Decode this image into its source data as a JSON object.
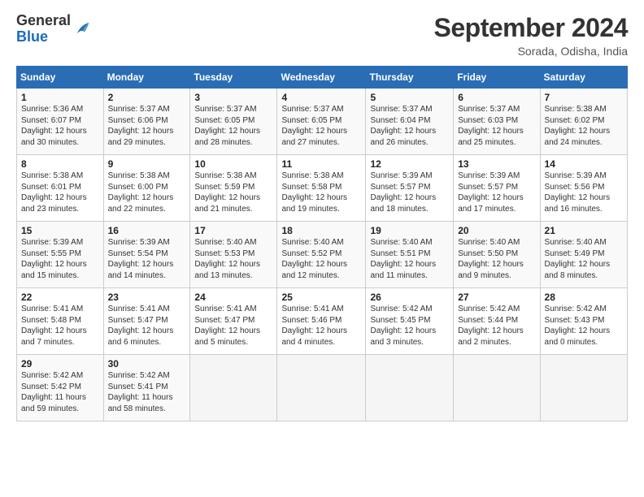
{
  "header": {
    "logo_line1": "General",
    "logo_line2": "Blue",
    "month": "September 2024",
    "location": "Sorada, Odisha, India"
  },
  "weekdays": [
    "Sunday",
    "Monday",
    "Tuesday",
    "Wednesday",
    "Thursday",
    "Friday",
    "Saturday"
  ],
  "weeks": [
    [
      {
        "day": "1",
        "info": "Sunrise: 5:36 AM\nSunset: 6:07 PM\nDaylight: 12 hours\nand 30 minutes."
      },
      {
        "day": "2",
        "info": "Sunrise: 5:37 AM\nSunset: 6:06 PM\nDaylight: 12 hours\nand 29 minutes."
      },
      {
        "day": "3",
        "info": "Sunrise: 5:37 AM\nSunset: 6:05 PM\nDaylight: 12 hours\nand 28 minutes."
      },
      {
        "day": "4",
        "info": "Sunrise: 5:37 AM\nSunset: 6:05 PM\nDaylight: 12 hours\nand 27 minutes."
      },
      {
        "day": "5",
        "info": "Sunrise: 5:37 AM\nSunset: 6:04 PM\nDaylight: 12 hours\nand 26 minutes."
      },
      {
        "day": "6",
        "info": "Sunrise: 5:37 AM\nSunset: 6:03 PM\nDaylight: 12 hours\nand 25 minutes."
      },
      {
        "day": "7",
        "info": "Sunrise: 5:38 AM\nSunset: 6:02 PM\nDaylight: 12 hours\nand 24 minutes."
      }
    ],
    [
      {
        "day": "8",
        "info": "Sunrise: 5:38 AM\nSunset: 6:01 PM\nDaylight: 12 hours\nand 23 minutes."
      },
      {
        "day": "9",
        "info": "Sunrise: 5:38 AM\nSunset: 6:00 PM\nDaylight: 12 hours\nand 22 minutes."
      },
      {
        "day": "10",
        "info": "Sunrise: 5:38 AM\nSunset: 5:59 PM\nDaylight: 12 hours\nand 21 minutes."
      },
      {
        "day": "11",
        "info": "Sunrise: 5:38 AM\nSunset: 5:58 PM\nDaylight: 12 hours\nand 19 minutes."
      },
      {
        "day": "12",
        "info": "Sunrise: 5:39 AM\nSunset: 5:57 PM\nDaylight: 12 hours\nand 18 minutes."
      },
      {
        "day": "13",
        "info": "Sunrise: 5:39 AM\nSunset: 5:57 PM\nDaylight: 12 hours\nand 17 minutes."
      },
      {
        "day": "14",
        "info": "Sunrise: 5:39 AM\nSunset: 5:56 PM\nDaylight: 12 hours\nand 16 minutes."
      }
    ],
    [
      {
        "day": "15",
        "info": "Sunrise: 5:39 AM\nSunset: 5:55 PM\nDaylight: 12 hours\nand 15 minutes."
      },
      {
        "day": "16",
        "info": "Sunrise: 5:39 AM\nSunset: 5:54 PM\nDaylight: 12 hours\nand 14 minutes."
      },
      {
        "day": "17",
        "info": "Sunrise: 5:40 AM\nSunset: 5:53 PM\nDaylight: 12 hours\nand 13 minutes."
      },
      {
        "day": "18",
        "info": "Sunrise: 5:40 AM\nSunset: 5:52 PM\nDaylight: 12 hours\nand 12 minutes."
      },
      {
        "day": "19",
        "info": "Sunrise: 5:40 AM\nSunset: 5:51 PM\nDaylight: 12 hours\nand 11 minutes."
      },
      {
        "day": "20",
        "info": "Sunrise: 5:40 AM\nSunset: 5:50 PM\nDaylight: 12 hours\nand 9 minutes."
      },
      {
        "day": "21",
        "info": "Sunrise: 5:40 AM\nSunset: 5:49 PM\nDaylight: 12 hours\nand 8 minutes."
      }
    ],
    [
      {
        "day": "22",
        "info": "Sunrise: 5:41 AM\nSunset: 5:48 PM\nDaylight: 12 hours\nand 7 minutes."
      },
      {
        "day": "23",
        "info": "Sunrise: 5:41 AM\nSunset: 5:47 PM\nDaylight: 12 hours\nand 6 minutes."
      },
      {
        "day": "24",
        "info": "Sunrise: 5:41 AM\nSunset: 5:47 PM\nDaylight: 12 hours\nand 5 minutes."
      },
      {
        "day": "25",
        "info": "Sunrise: 5:41 AM\nSunset: 5:46 PM\nDaylight: 12 hours\nand 4 minutes."
      },
      {
        "day": "26",
        "info": "Sunrise: 5:42 AM\nSunset: 5:45 PM\nDaylight: 12 hours\nand 3 minutes."
      },
      {
        "day": "27",
        "info": "Sunrise: 5:42 AM\nSunset: 5:44 PM\nDaylight: 12 hours\nand 2 minutes."
      },
      {
        "day": "28",
        "info": "Sunrise: 5:42 AM\nSunset: 5:43 PM\nDaylight: 12 hours\nand 0 minutes."
      }
    ],
    [
      {
        "day": "29",
        "info": "Sunrise: 5:42 AM\nSunset: 5:42 PM\nDaylight: 11 hours\nand 59 minutes."
      },
      {
        "day": "30",
        "info": "Sunrise: 5:42 AM\nSunset: 5:41 PM\nDaylight: 11 hours\nand 58 minutes."
      },
      {
        "day": "",
        "info": ""
      },
      {
        "day": "",
        "info": ""
      },
      {
        "day": "",
        "info": ""
      },
      {
        "day": "",
        "info": ""
      },
      {
        "day": "",
        "info": ""
      }
    ]
  ]
}
